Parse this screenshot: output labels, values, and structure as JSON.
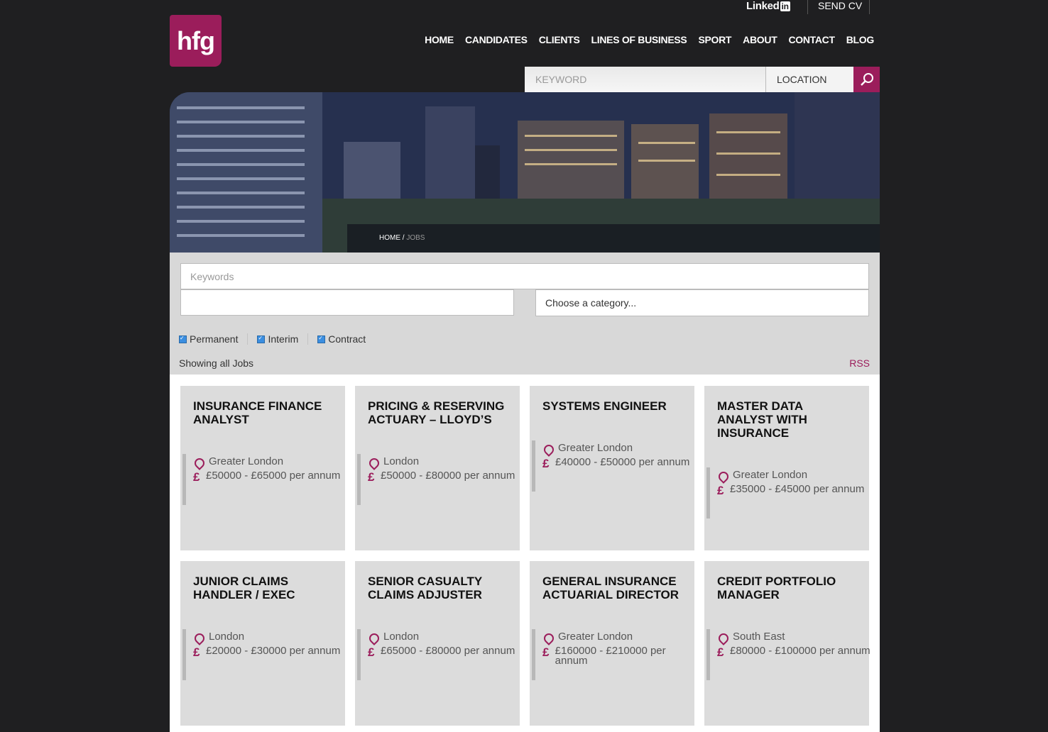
{
  "header": {
    "linkedin_label": "Linked",
    "linkedin_badge": "in",
    "send_cv": "SEND CV",
    "logo": "hfg",
    "nav": [
      "HOME",
      "CANDIDATES",
      "CLIENTS",
      "LINES OF BUSINESS",
      "SPORT",
      "ABOUT",
      "CONTACT",
      "BLOG"
    ],
    "search": {
      "keyword_placeholder": "KEYWORD",
      "location_placeholder": "LOCATION"
    }
  },
  "breadcrumb": {
    "home": "HOME",
    "sep": " / ",
    "current": "JOBS"
  },
  "filters": {
    "keywords_placeholder": "Keywords",
    "category_placeholder": "Choose a category...",
    "types": [
      "Permanent",
      "Interim",
      "Contract"
    ],
    "showing": "Showing all Jobs",
    "rss": "RSS"
  },
  "jobs": [
    {
      "title": "INSURANCE FINANCE ANALYST",
      "location": "Greater London",
      "salary": "£50000 - £65000 per annum"
    },
    {
      "title": "PRICING & RESERVING ACTUARY – LLOYD’S",
      "location": "London",
      "salary": "£50000 - £80000 per annum"
    },
    {
      "title": "SYSTEMS ENGINEER",
      "location": "Greater London",
      "salary": "£40000 - £50000 per annum"
    },
    {
      "title": "MASTER DATA ANALYST WITH INSURANCE",
      "location": "Greater London",
      "salary": "£35000 - £45000 per annum"
    },
    {
      "title": "JUNIOR CLAIMS HANDLER / EXEC",
      "location": "London",
      "salary": "£20000 - £30000 per annum"
    },
    {
      "title": "SENIOR CASUALTY CLAIMS ADJUSTER",
      "location": "London",
      "salary": "£65000 - £80000 per annum"
    },
    {
      "title": "GENERAL INSURANCE ACTUARIAL DIRECTOR",
      "location": "Greater London",
      "salary": "£160000 - £210000 per annum"
    },
    {
      "title": "CREDIT PORTFOLIO MANAGER",
      "location": "South East",
      "salary": "£80000 - £100000 per annum"
    }
  ],
  "colors": {
    "brand": "#9b1d5b",
    "background": "#1f1f21"
  }
}
